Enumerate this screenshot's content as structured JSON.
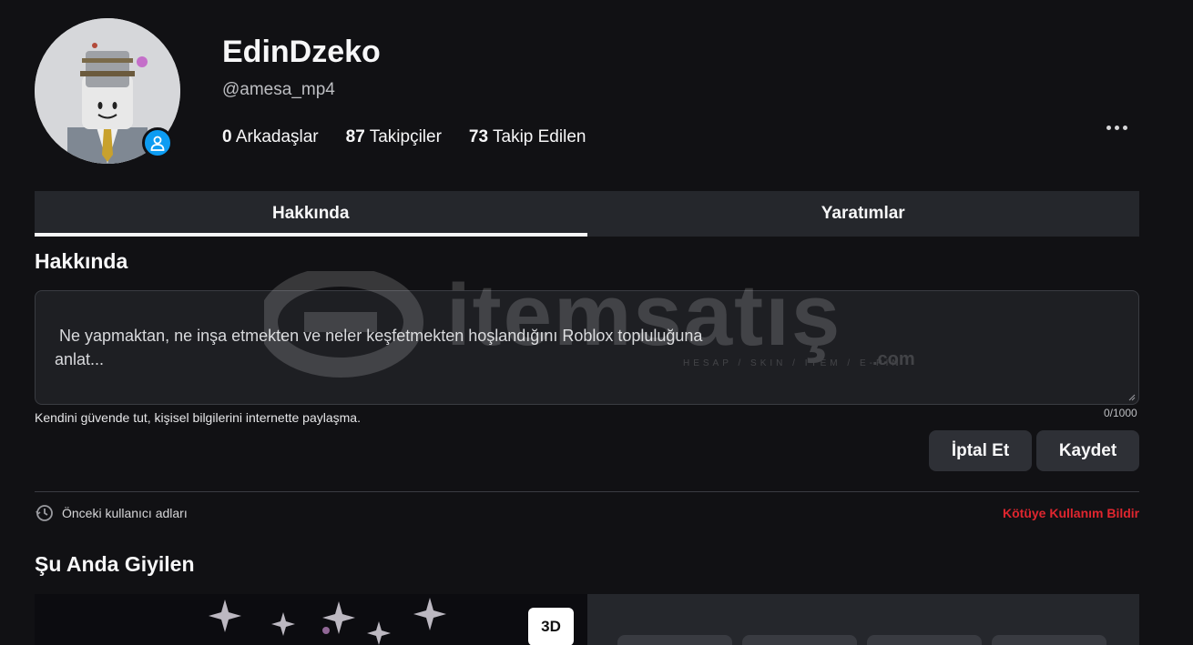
{
  "profile": {
    "display_name": "EdinDzeko",
    "username": "@amesa_mp4",
    "stats": [
      {
        "count": "0",
        "label": "Arkadaşlar"
      },
      {
        "count": "87",
        "label": "Takipçiler"
      },
      {
        "count": "73",
        "label": "Takip Edilen"
      }
    ]
  },
  "tabs": [
    {
      "label": "Hakkında",
      "active": true
    },
    {
      "label": "Yaratımlar",
      "active": false
    }
  ],
  "about": {
    "title": "Hakkında",
    "placeholder": "Ne yapmaktan, ne inşa etmekten ve neler keşfetmekten hoşlandığını Roblox topluluğuna\n anlat...",
    "safety_note": "Kendini güvende tut, kişisel bilgilerini internette paylaşma.",
    "counter": "0/1000",
    "cancel_label": "İptal Et",
    "save_label": "Kaydet"
  },
  "footer": {
    "previous_usernames": "Önceki kullanıcı adları",
    "report_abuse": "Kötüye Kullanım Bildir"
  },
  "wearing": {
    "title": "Şu Anda Giyilen",
    "view_3d_label": "3D"
  },
  "watermark": {
    "brand": "itemsatış",
    "tagline": "HESAP / SKIN / ITEM / E-PIN",
    "domain": ".com"
  },
  "colors": {
    "background": "#111114",
    "panel": "#25272c",
    "presence": "#0d9cf2",
    "report": "#e0262f"
  }
}
